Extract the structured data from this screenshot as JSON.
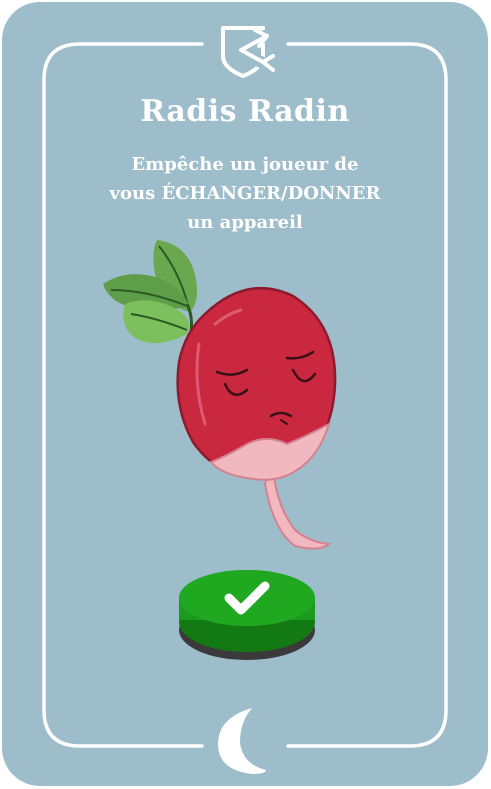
{
  "card": {
    "title": "Radis Radin",
    "description_lines": [
      "Empêche un joueur de",
      "vous ÉCHANGER/DONNER",
      "un appareil"
    ],
    "colors": {
      "background": "#9dbdcb",
      "frame": "#ffffff",
      "radish_body": "#c9283f",
      "radish_tip": "#f2b8c0",
      "leaves": "#6aa84f",
      "button": "#1c9a1c",
      "button_base": "#3a3a3a"
    },
    "icons": {
      "top": "exchange-blocked-icon",
      "bottom": "moon-icon",
      "confirm": "checkmark-icon"
    }
  }
}
